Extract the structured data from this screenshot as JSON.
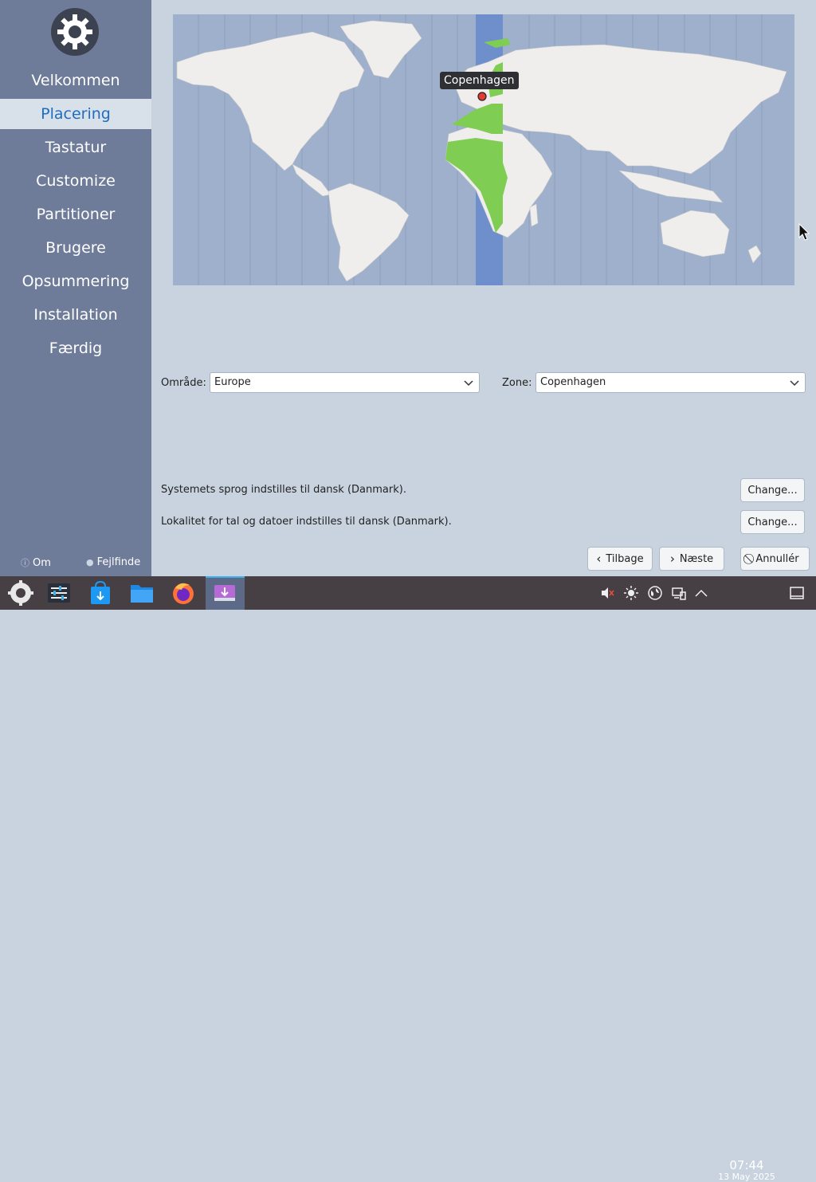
{
  "sidebar": {
    "items": [
      {
        "label": "Velkommen",
        "active": false
      },
      {
        "label": "Placering",
        "active": true
      },
      {
        "label": "Tastatur",
        "active": false
      },
      {
        "label": "Customize",
        "active": false
      },
      {
        "label": "Partitioner",
        "active": false
      },
      {
        "label": "Brugere",
        "active": false
      },
      {
        "label": "Opsummering",
        "active": false
      },
      {
        "label": "Installation",
        "active": false
      },
      {
        "label": "Færdig",
        "active": false
      }
    ],
    "footer_about": "Om",
    "footer_debug": "Fejlfinde"
  },
  "map": {
    "selected_city": "Copenhagen",
    "ocean_color": "#9eb0cc",
    "land_color": "#f0eeec",
    "highlight_color": "#7fcd52",
    "band_color": "#6e8fcc"
  },
  "location": {
    "region_label": "Område:",
    "region_value": "Europe",
    "zone_label": "Zone:",
    "zone_value": "Copenhagen"
  },
  "locale": {
    "language_text": "Systemets sprog indstilles til dansk (Danmark).",
    "language_button": "Change...",
    "numbers_text": "Lokalitet for tal og datoer indstilles til dansk (Danmark).",
    "numbers_button": "Change..."
  },
  "navigation": {
    "back": "Tilbage",
    "next": "Næste",
    "cancel": "Annullér"
  },
  "taskbar": {
    "apps": [
      "kde-menu-icon",
      "system-settings-icon",
      "discover-store-icon",
      "file-manager-icon",
      "firefox-icon",
      "installer-icon"
    ],
    "active_app": "installer-icon",
    "time": "07:44",
    "date": "13 May 2025"
  }
}
